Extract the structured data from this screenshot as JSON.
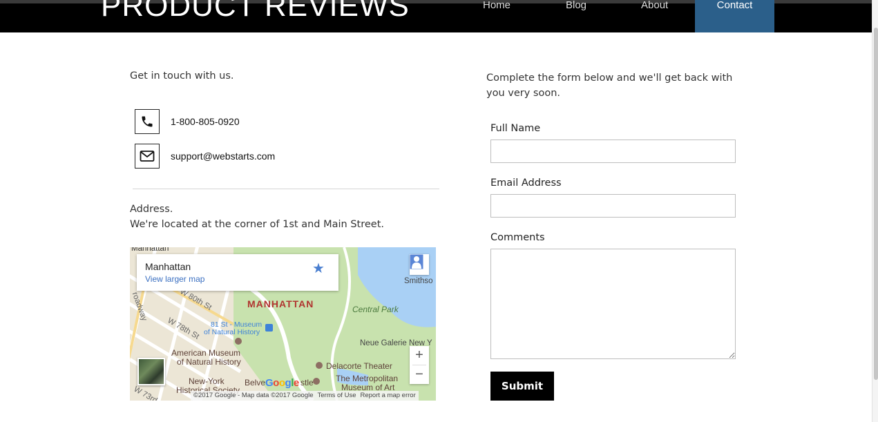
{
  "header": {
    "logo": "PRODUCT REVIEWS",
    "nav": [
      {
        "label": "Home"
      },
      {
        "label": "Blog"
      },
      {
        "label": "About"
      },
      {
        "label": "Contact"
      }
    ],
    "active_nav": "Contact",
    "active_color": "#2b5f8a"
  },
  "contact": {
    "intro": "Get in touch with us.",
    "phone": "1-800-805-0920",
    "email": "support@webstarts.com",
    "phone_icon": "phone-icon",
    "email_icon": "envelope-icon",
    "address_title": "Address.",
    "address_line": "We're located at the corner of 1st and Main Street."
  },
  "map": {
    "card_title": "Manhattan",
    "card_link": "View larger map",
    "labels": {
      "manhattan": "MANHATTAN",
      "central_park": "Central Park",
      "museum_81": "81 St - Museum",
      "museum_81b": "of Natural History",
      "amnh1": "American Museum",
      "amnh2": "of Natural History",
      "neue": "Neue Galerie New Y",
      "delacorte": "Delacorte Theater",
      "met1": "The Metropolitan",
      "met2": "Museum of Art",
      "nyhs1": "New-York",
      "nyhs2": "Historical Society",
      "belve": "Belve",
      "castle": "stle",
      "w80": "W 80th St",
      "w78": "W 78th St",
      "w73": "W 73rd",
      "smiths": "Smithso",
      "manhattan_top": "Manhattan",
      "broadway": "roadway",
      "google": "Google"
    },
    "footer": [
      "©2017 Google - Map data ©2017 Google",
      "Terms of Use",
      "Report a map error"
    ],
    "zoom_in": "+",
    "zoom_out": "−"
  },
  "form": {
    "intro": "Complete the form below and we'll get back with you very soon.",
    "full_name_label": "Full Name",
    "full_name_value": "",
    "email_label": "Email Address",
    "email_value": "",
    "comments_label": "Comments",
    "comments_value": "",
    "submit_label": "Submit"
  }
}
